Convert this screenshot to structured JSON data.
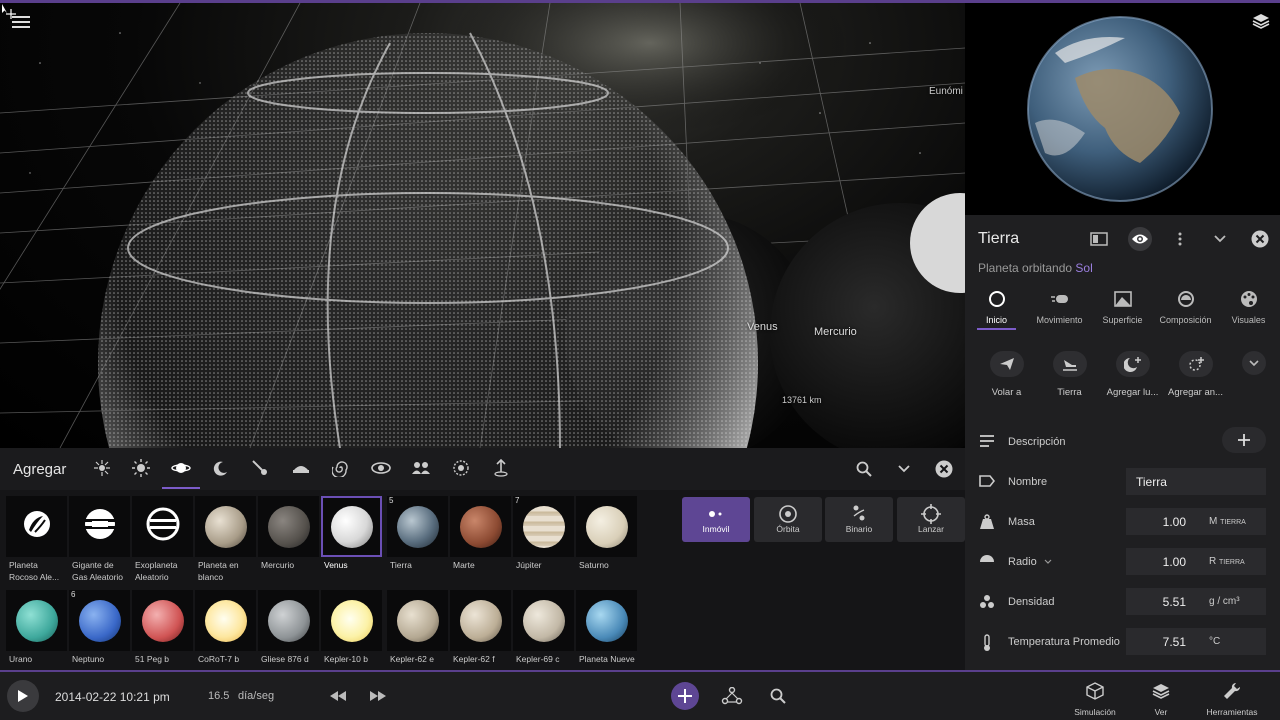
{
  "viewport": {
    "labels": {
      "eunomia": "Eunómi",
      "venus": "Venus",
      "mercurio": "Mercurio",
      "distance": "13761 km"
    }
  },
  "panel": {
    "title": "Tierra",
    "subtitle_prefix": "Planeta orbitando",
    "subtitle_link": "Sol",
    "tabs": [
      "Inicio",
      "Movimiento",
      "Superficie",
      "Composición",
      "Visuales"
    ],
    "actions": [
      "Volar a",
      "Tierra",
      "Agregar lu...",
      "Agregar an..."
    ],
    "description_label": "Descripción",
    "properties": {
      "nombre": {
        "label": "Nombre",
        "value": "Tierra"
      },
      "masa": {
        "label": "Masa",
        "value": "1.00",
        "unit": "M",
        "unit_sub": "TIERRA"
      },
      "radio": {
        "label": "Radio",
        "value": "1.00",
        "unit": "R",
        "unit_sub": "TIERRA"
      },
      "densidad": {
        "label": "Densidad",
        "value": "5.51",
        "unit": "g / cm³"
      },
      "temperatura": {
        "label": "Temperatura Promedio",
        "value": "7.51",
        "unit": "°C"
      }
    }
  },
  "add_panel": {
    "title": "Agregar",
    "items_row1": [
      {
        "label": "Planeta Rocoso Ale...",
        "badge": ""
      },
      {
        "label": "Gigante de Gas Aleatorio",
        "badge": ""
      },
      {
        "label": "Exoplaneta Aleatorio",
        "badge": ""
      },
      {
        "label": "Planeta en blanco",
        "badge": ""
      },
      {
        "label": "Mercurio",
        "badge": ""
      },
      {
        "label": "Venus",
        "badge": ""
      },
      {
        "label": "Tierra",
        "badge": "5"
      },
      {
        "label": "Marte",
        "badge": ""
      },
      {
        "label": "Júpiter",
        "badge": "7"
      },
      {
        "label": "Saturno",
        "badge": ""
      }
    ],
    "items_row2": [
      {
        "label": "Urano",
        "badge": ""
      },
      {
        "label": "Neptuno",
        "badge": "6"
      },
      {
        "label": "51 Peg b",
        "badge": ""
      },
      {
        "label": "CoRoT-7 b",
        "badge": ""
      },
      {
        "label": "Gliese 876 d",
        "badge": ""
      },
      {
        "label": "Kepler-10 b",
        "badge": ""
      },
      {
        "label": "Kepler-62 e",
        "badge": ""
      },
      {
        "label": "Kepler-62 f",
        "badge": ""
      },
      {
        "label": "Kepler-69 c",
        "badge": ""
      },
      {
        "label": "Planeta Nueve",
        "badge": ""
      }
    ],
    "modes": [
      "Inmóvil",
      "Órbita",
      "Binario",
      "Lanzar"
    ]
  },
  "bottom": {
    "datetime": "2014-02-22 10:21 pm",
    "speed": "16.5",
    "speed_unit": "día/seg",
    "nav": [
      "Simulación",
      "Ver",
      "Herramientas"
    ]
  },
  "colors": {
    "accent": "#7c5cc9",
    "accent_bg": "#5e4694",
    "panel_bg": "#1f1f21",
    "bar_bg": "#1d1d1f"
  }
}
